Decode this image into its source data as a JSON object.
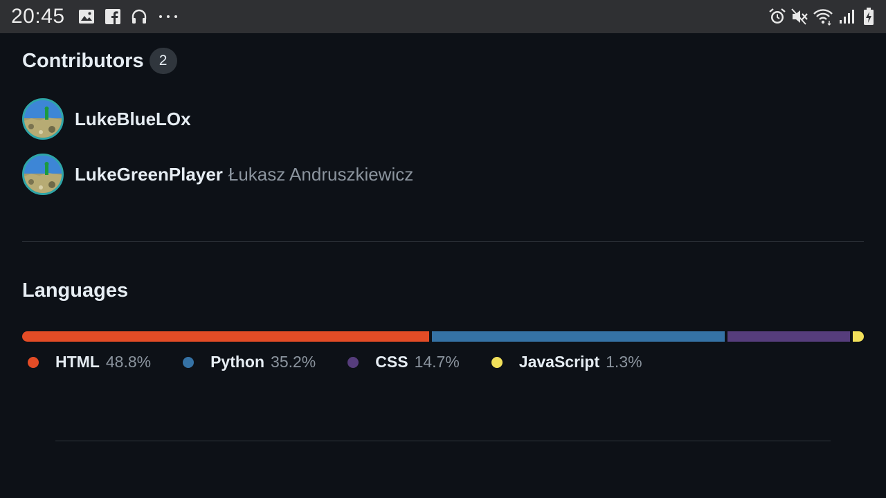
{
  "status_bar": {
    "time": "20:45",
    "left_icons": [
      "image-icon",
      "facebook-icon",
      "headphones-icon",
      "more-icon"
    ],
    "right_icons": [
      "alarm-icon",
      "mute-icon",
      "wifi-icon",
      "signal-icon",
      "battery-icon"
    ]
  },
  "contributors": {
    "title": "Contributors",
    "count": "2",
    "items": [
      {
        "login": "LukeBlueLOx",
        "name": ""
      },
      {
        "login": "LukeGreenPlayer",
        "name": "Łukasz Andruszkiewicz"
      }
    ]
  },
  "languages": {
    "title": "Languages",
    "items": [
      {
        "name": "HTML",
        "percent": "48.8%",
        "value": 48.8,
        "color": "#e34c26"
      },
      {
        "name": "Python",
        "percent": "35.2%",
        "value": 35.2,
        "color": "#3572a5"
      },
      {
        "name": "CSS",
        "percent": "14.7%",
        "value": 14.7,
        "color": "#563d7c"
      },
      {
        "name": "JavaScript",
        "percent": "1.3%",
        "value": 1.3,
        "color": "#f1e05a"
      }
    ]
  }
}
